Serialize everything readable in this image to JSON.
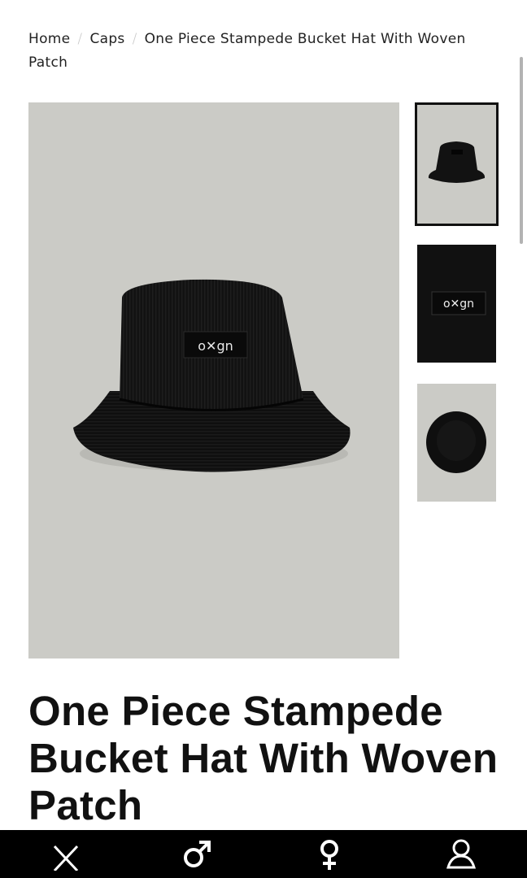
{
  "breadcrumb": {
    "home": "Home",
    "category": "Caps",
    "current": "One Piece Stampede Bucket Hat With Woven Patch",
    "separator": "/"
  },
  "product": {
    "title": "One Piece Stampede Bucket Hat With Woven Patch",
    "image_alt": "Black corduroy bucket hat with woven patch",
    "patch_text": "o✕gn"
  },
  "thumbnails": [
    {
      "name": "front view",
      "selected": true
    },
    {
      "name": "patch close-up",
      "selected": false
    },
    {
      "name": "top view",
      "selected": false
    }
  ],
  "bottom_nav": {
    "items": [
      {
        "icon": "close-icon"
      },
      {
        "icon": "male-icon"
      },
      {
        "icon": "female-icon"
      },
      {
        "icon": "account-icon"
      }
    ]
  },
  "colors": {
    "image_background": "#cbcbc6",
    "hat": "#111111",
    "nav_background": "#000000"
  }
}
